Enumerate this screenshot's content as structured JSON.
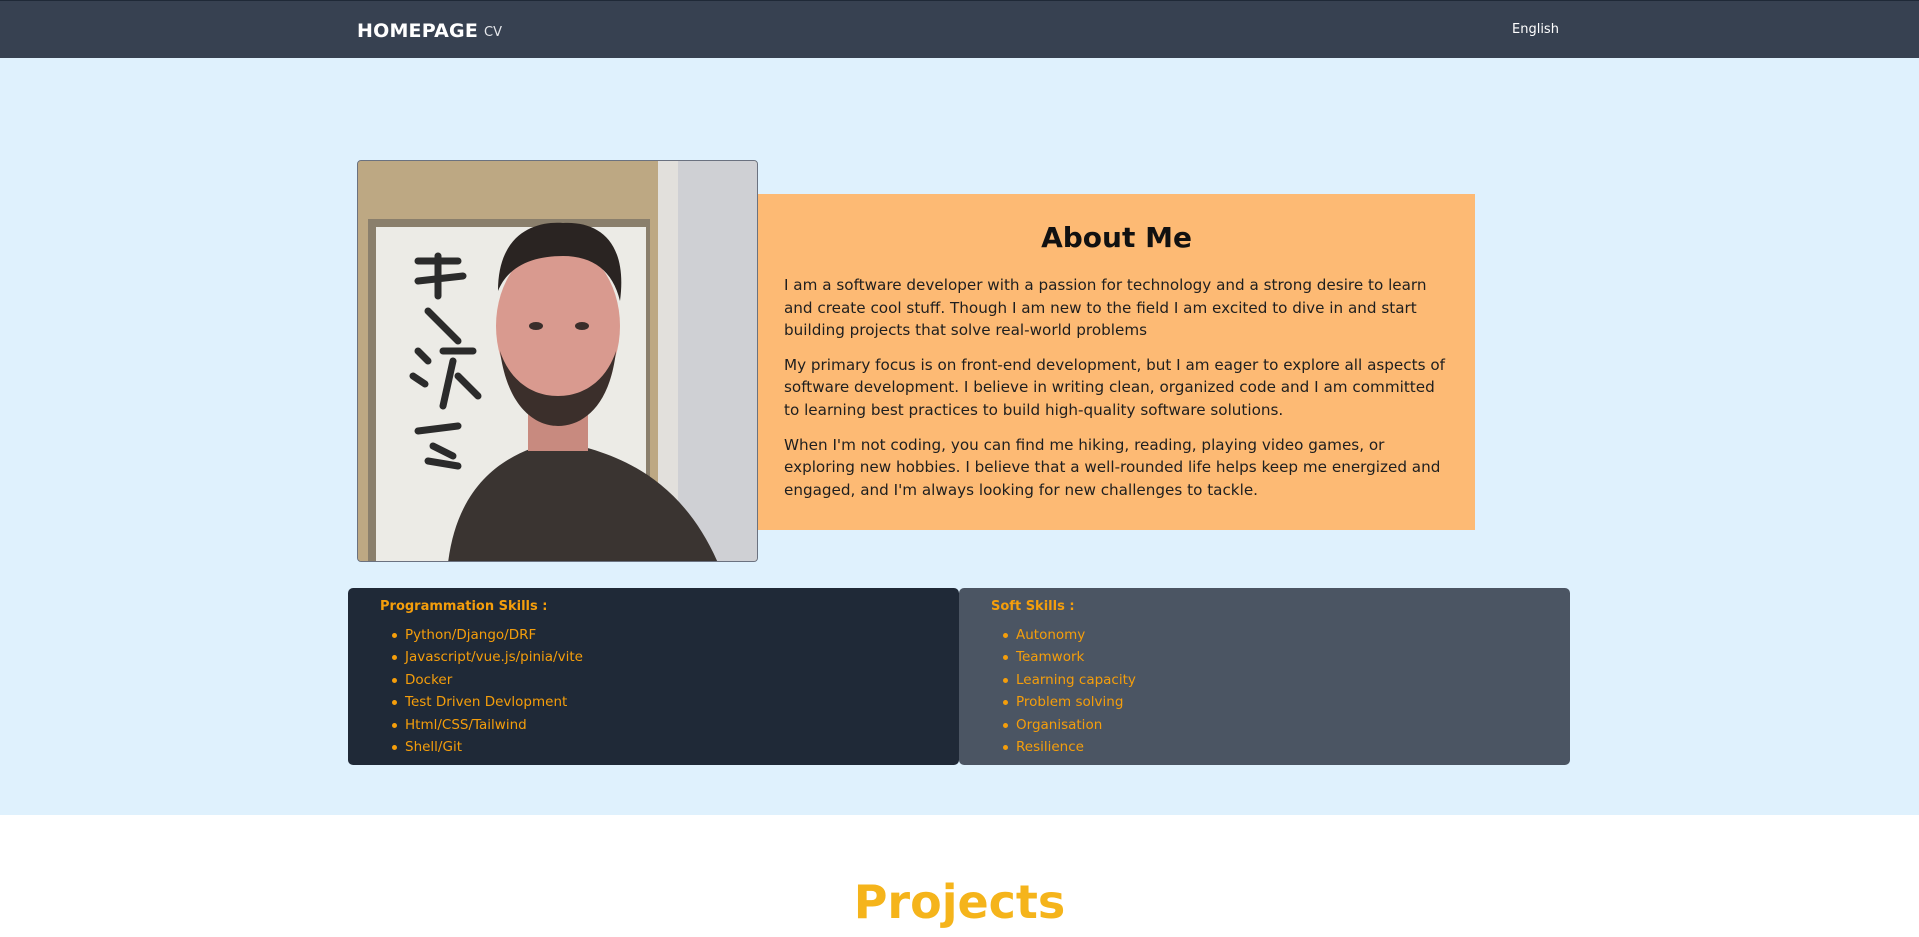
{
  "nav": {
    "brand": "HOMEPAGE",
    "cv": "CV",
    "language": "English"
  },
  "about": {
    "title": "About Me",
    "paragraphs": [
      "I am a software developer with a passion for technology and a strong desire to learn and create cool stuff. Though I am new to the field I am excited to dive in and start building projects that solve real-world problems",
      "My primary focus is on front-end development, but I am eager to explore all aspects of software development. I believe in writing clean, organized code and I am committed to learning best practices to build high-quality software solutions.",
      "When I'm not coding, you can find me hiking, reading, playing video games, or exploring new hobbies. I believe that a well-rounded life helps keep me energized and engaged, and I'm always looking for new challenges to tackle."
    ]
  },
  "skills": {
    "programming": {
      "title": "Programmation Skills :",
      "items": [
        "Python/Django/DRF",
        "Javascript/vue.js/pinia/vite",
        "Docker",
        "Test Driven Devlopment",
        "Html/CSS/Tailwind",
        "Shell/Git"
      ]
    },
    "soft": {
      "title": "Soft Skills :",
      "items": [
        "Autonomy",
        "Teamwork",
        "Learning capacity",
        "Problem solving",
        "Organisation",
        "Resilience"
      ]
    }
  },
  "projects": {
    "title": "Projects"
  },
  "colors": {
    "navbar": "#374151",
    "hero_bg": "#dff1fd",
    "about_bg": "#fdba74",
    "prog_card": "#1f2937",
    "soft_card": "#4b5563",
    "skill_text": "#f59e0b",
    "projects_title": "#f5b41b"
  }
}
